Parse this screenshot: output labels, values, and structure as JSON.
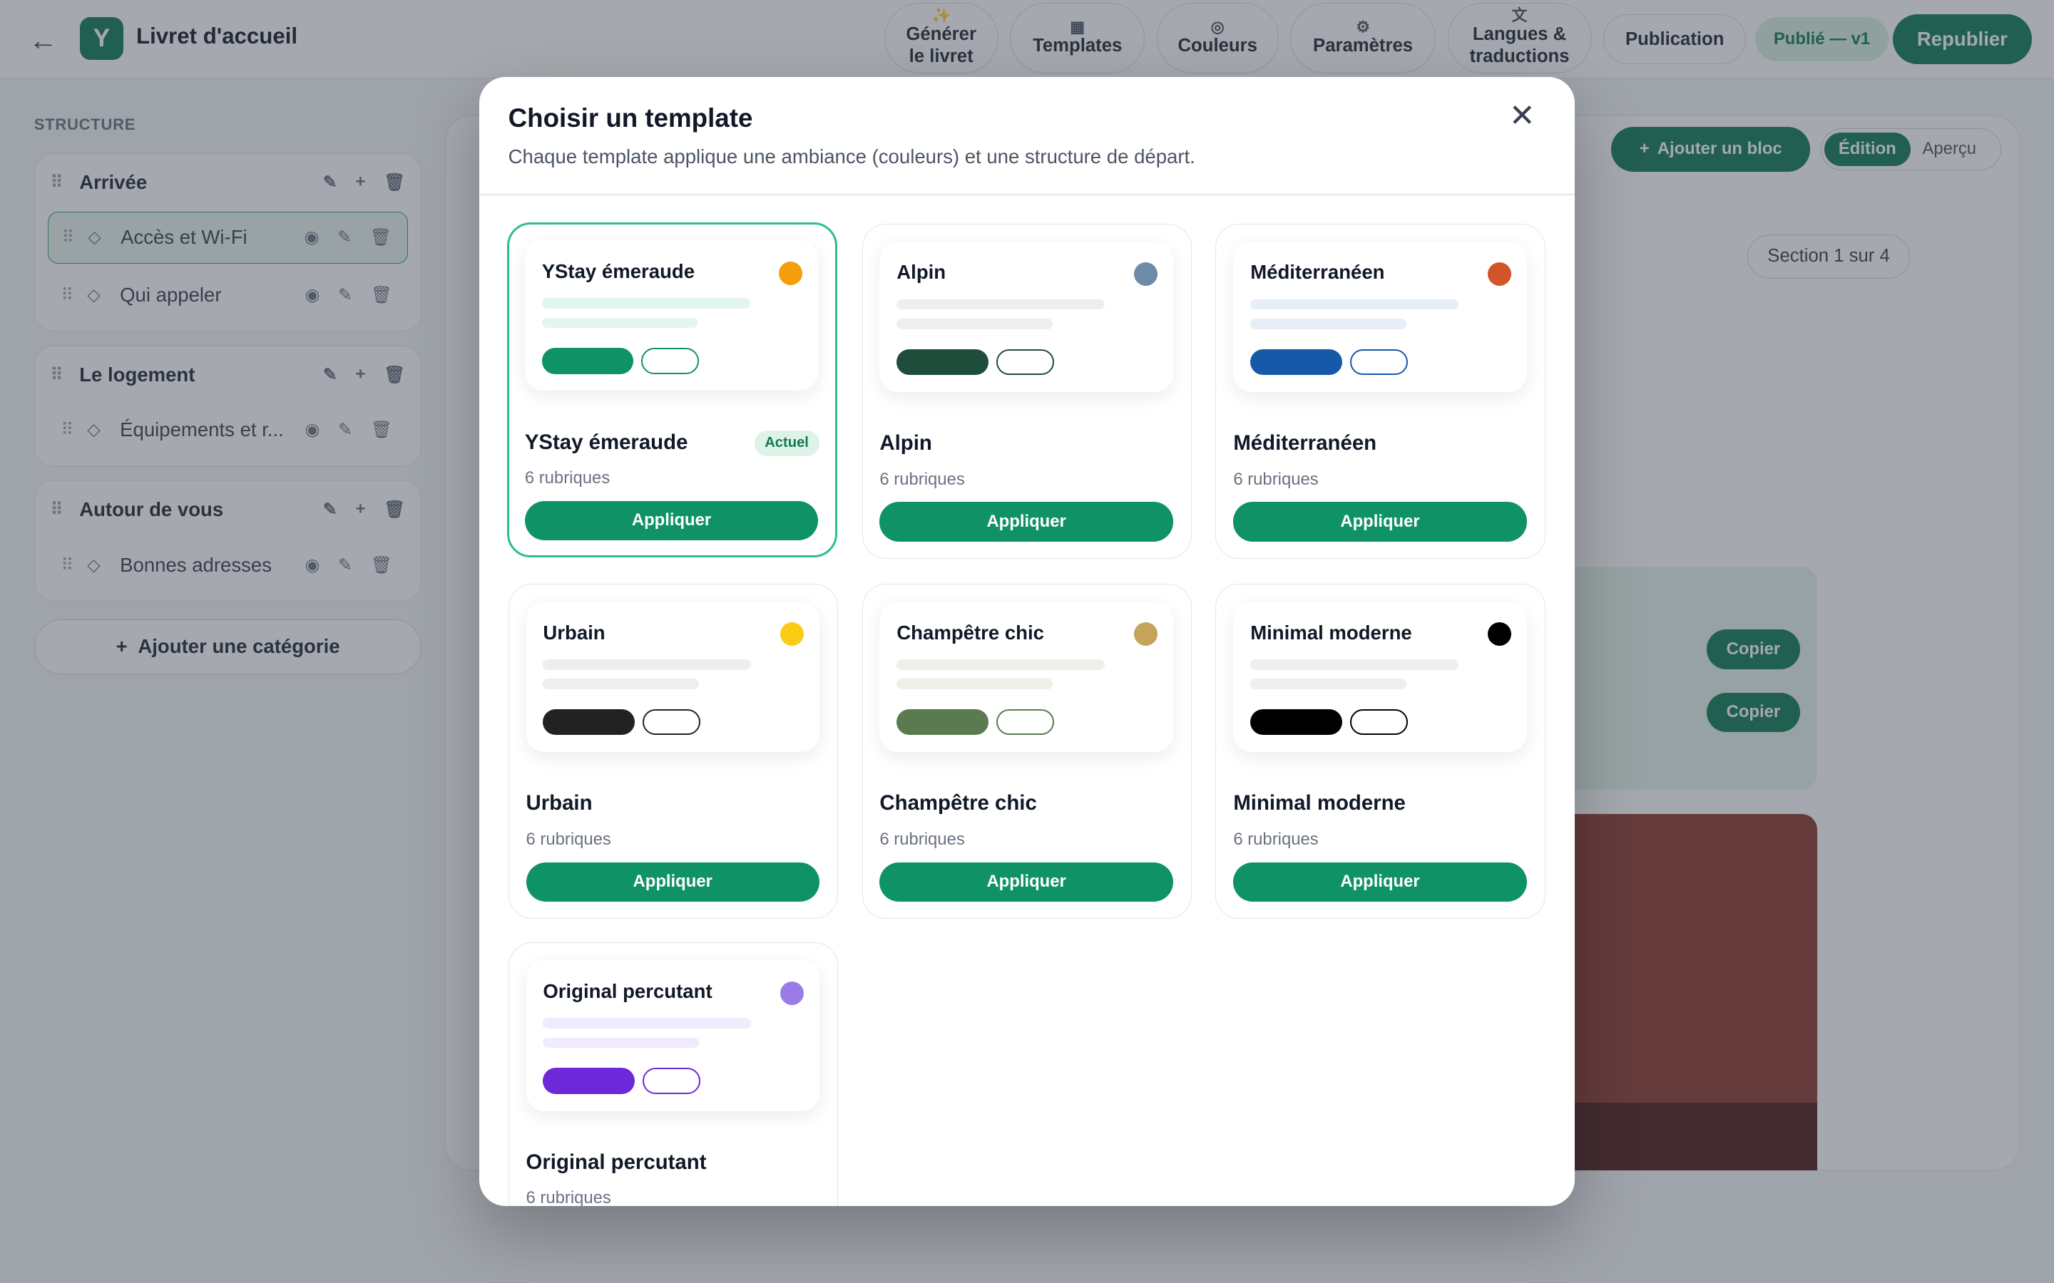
{
  "topbar": {
    "back_icon": "←",
    "logo_letter": "Y",
    "title": "Livret d'accueil",
    "buttons": [
      {
        "icon": "✨",
        "label": "Générer le livret"
      },
      {
        "icon": "▦",
        "label": "Templates"
      },
      {
        "icon": "◎",
        "label": "Couleurs"
      },
      {
        "icon": "⚙",
        "label": "Paramètres"
      },
      {
        "icon": "文",
        "label": "Langues & traductions"
      },
      {
        "icon": "",
        "label": "Publication"
      }
    ],
    "status": "Publié — v1",
    "republish": "Republier"
  },
  "sidebar": {
    "title": "STRUCTURE",
    "categories": [
      {
        "name": "Arrivée",
        "items": [
          "Accès et Wi-Fi",
          "Qui appeler"
        ]
      },
      {
        "name": "Le logement",
        "items": [
          "Équipements et r..."
        ]
      },
      {
        "name": "Autour de vous",
        "items": [
          "Bonnes adresses"
        ]
      }
    ],
    "add_category": "Ajouter une catégorie"
  },
  "editor": {
    "add_block": "Ajouter un bloc",
    "mode_edit": "Édition",
    "mode_preview": "Aperçu",
    "section_badge": "Section 1 sur 4",
    "copy_label": "Copier"
  },
  "modal": {
    "title": "Choisir un template",
    "subtitle": "Chaque template applique une ambiance (couleurs) et une structure de départ.",
    "close_icon": "✕",
    "apply_label": "Appliquer",
    "current_label": "Actuel",
    "templates": [
      {
        "name": "YStay émeraude",
        "count": "6 rubriques",
        "dot": "#f59e0b",
        "primary": "#0f9366",
        "line": "#e3f6ee",
        "current": true
      },
      {
        "name": "Alpin",
        "count": "6 rubriques",
        "dot": "#6b8ba8",
        "primary": "#1e4d3b",
        "line": "#eceef0",
        "current": false
      },
      {
        "name": "Méditerranéen",
        "count": "6 rubriques",
        "dot": "#d2552a",
        "primary": "#1559a8",
        "line": "#e8eef8",
        "current": false
      },
      {
        "name": "Urbain",
        "count": "6 rubriques",
        "dot": "#facc15",
        "primary": "#222222",
        "line": "#eeeeee",
        "current": false
      },
      {
        "name": "Champêtre chic",
        "count": "6 rubriques",
        "dot": "#c4a35a",
        "primary": "#5a7a4f",
        "line": "#eef0ea",
        "current": false
      },
      {
        "name": "Minimal moderne",
        "count": "6 rubriques",
        "dot": "#000000",
        "primary": "#000000",
        "line": "#efefef",
        "current": false
      },
      {
        "name": "Original percutant",
        "count": "6 rubriques",
        "dot": "#9b7be6",
        "primary": "#6d28d9",
        "line": "#f1ebfd",
        "current": false
      }
    ]
  }
}
